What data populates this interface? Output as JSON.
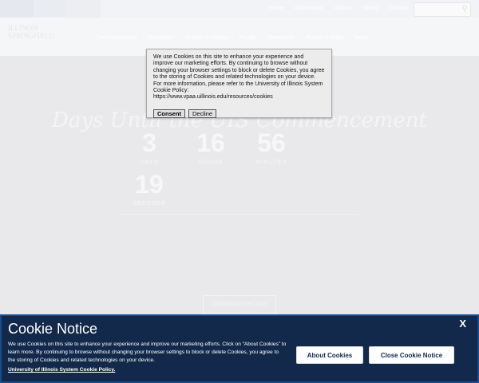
{
  "site": {
    "top_tabs": [
      "",
      "",
      "",
      ""
    ],
    "utility_links": [
      "Home",
      "Admissions",
      "Alumni",
      "Giving",
      "Contact"
    ],
    "search": {
      "placeholder": ""
    },
    "logo_text": "ILLINOIS\nSPRINGFIELD",
    "main_nav": [
      "Commencement",
      "Graduates",
      "Guests & Visitors",
      "Faculty",
      "Ceremony",
      "Photos & Video",
      "News"
    ],
    "hero": {
      "title": "Days Until the UIS Commencement",
      "countdown": [
        {
          "value": "3",
          "unit": "DAYS"
        },
        {
          "value": "16",
          "unit": "HOURS"
        },
        {
          "value": "56",
          "unit": "MINUTES"
        },
        {
          "value": "19",
          "unit": "SECONDS"
        }
      ],
      "button_label": "CEREMONY DETAILS"
    }
  },
  "popup": {
    "text": "We use Cookies on this site to enhance your experience and improve our marketing efforts. By continuing to browse without changing your browser settings to block or delete Cookies, you agree to the storing of Cookies and related technologies on your device. For more information, please refer to the University of Illinois System Cookie Policy:",
    "url": "https://www.vpaa.uillinois.edu/resources/cookies",
    "consent_label": "Consent",
    "decline_label": "Decline"
  },
  "cookie_notice": {
    "title": "Cookie Notice",
    "description": "We use Cookies on this site to enhance your experience and improve our marketing efforts. Click on “About Cookies” to learn more. By continuing to browse without changing your browser settings to block or delete Cookies, you agree to the storing of Cookies and related technologies on your device.",
    "policy_link": "University of Illinois System Cookie Policy.",
    "about_label": "About Cookies",
    "close_label": "Close Cookie Notice",
    "close_x": "X"
  },
  "colors": {
    "notice_bg": "#13294b",
    "notice_border": "#1a4c8c",
    "page_dim": "#e9e9ec"
  }
}
